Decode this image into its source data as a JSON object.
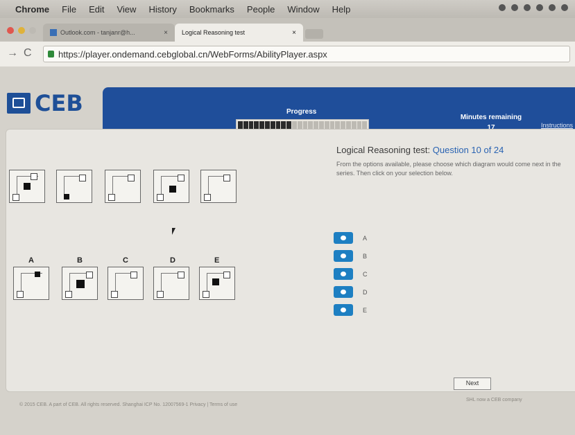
{
  "menubar": {
    "app": "Chrome",
    "items": [
      "File",
      "Edit",
      "View",
      "History",
      "Bookmarks",
      "People",
      "Window",
      "Help"
    ]
  },
  "tabs": [
    {
      "label": "Outlook.com - tanjanr@h...",
      "favicon": "outlook-icon"
    },
    {
      "label": "Logical Reasoning test",
      "favicon": "page-icon"
    }
  ],
  "address": {
    "url": "https://player.ondemand.cebglobal.cn/WebForms/AbilityPlayer.aspx"
  },
  "header": {
    "logo": "CEB",
    "progress_label": "Progress",
    "progress_fraction": 0.4,
    "minutes_label": "Minutes remaining",
    "minutes_value": "17",
    "instructions": "Instructions"
  },
  "question": {
    "title_prefix": "Logical Reasoning test: ",
    "title_number": "Question 10 of 24",
    "text": "From the options available, please choose which diagram would come next in the series. Then click on your selection below."
  },
  "options": [
    "A",
    "B",
    "C",
    "D",
    "E"
  ],
  "next_label": "Next",
  "footer": {
    "left": "© 2015 CEB. A part of CEB. All rights reserved. Shanghai ICP No. 12007569-1 Privacy | Terms of use",
    "right": "SHL now a CEB company"
  },
  "colors": {
    "brand": "#1f4e9a",
    "radio": "#1d7fc2"
  }
}
